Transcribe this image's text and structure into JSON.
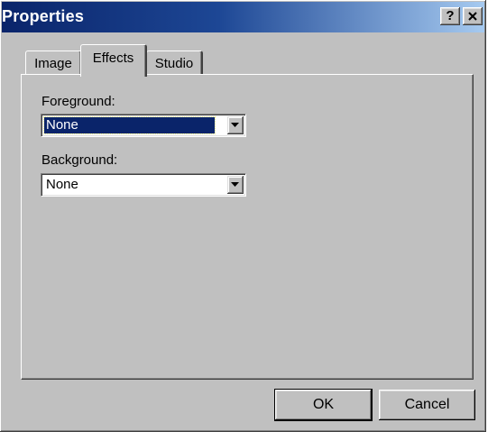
{
  "window": {
    "title": "Properties",
    "help_label": "?"
  },
  "tabs": [
    {
      "label": "Image",
      "selected": false
    },
    {
      "label": "Effects",
      "selected": true
    },
    {
      "label": "Studio",
      "selected": false
    }
  ],
  "effects": {
    "foreground": {
      "label": "Foreground:",
      "value": "None"
    },
    "background": {
      "label": "Background:",
      "value": "None"
    }
  },
  "buttons": {
    "ok": "OK",
    "cancel": "Cancel"
  },
  "icons": {
    "close": "close-icon",
    "help": "help-icon",
    "dropdown": "chevron-down-icon"
  },
  "colors": {
    "titlebar_start": "#0a246a",
    "titlebar_end": "#a6caf0",
    "face": "#c0c0c0",
    "selection": "#0a246a"
  }
}
